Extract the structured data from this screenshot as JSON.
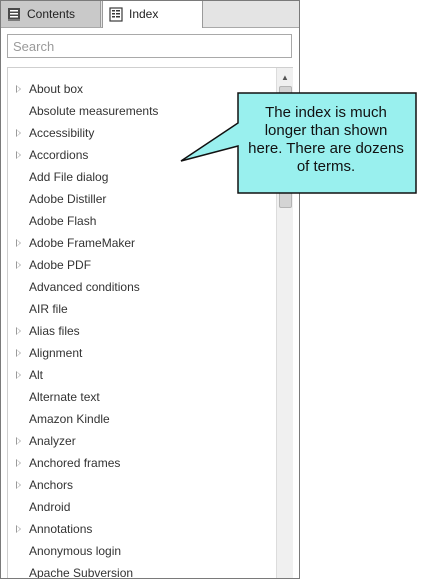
{
  "tabs": {
    "contents": {
      "label": "Contents",
      "icon": "book-icon"
    },
    "index": {
      "label": "Index",
      "icon": "index-page-icon"
    }
  },
  "search": {
    "placeholder": "Search",
    "value": ""
  },
  "index_items": [
    {
      "label": "About box",
      "expandable": true
    },
    {
      "label": "Absolute measurements",
      "expandable": false
    },
    {
      "label": "Accessibility",
      "expandable": true
    },
    {
      "label": "Accordions",
      "expandable": true
    },
    {
      "label": "Add File dialog",
      "expandable": false
    },
    {
      "label": "Adobe Distiller",
      "expandable": false
    },
    {
      "label": "Adobe Flash",
      "expandable": false
    },
    {
      "label": "Adobe FrameMaker",
      "expandable": true
    },
    {
      "label": "Adobe PDF",
      "expandable": true
    },
    {
      "label": "Advanced conditions",
      "expandable": false
    },
    {
      "label": "AIR file",
      "expandable": false
    },
    {
      "label": "Alias files",
      "expandable": true
    },
    {
      "label": "Alignment",
      "expandable": true
    },
    {
      "label": "Alt",
      "expandable": true
    },
    {
      "label": "Alternate text",
      "expandable": false
    },
    {
      "label": "Amazon Kindle",
      "expandable": false
    },
    {
      "label": "Analyzer",
      "expandable": true
    },
    {
      "label": "Anchored frames",
      "expandable": true
    },
    {
      "label": "Anchors",
      "expandable": true
    },
    {
      "label": "Android",
      "expandable": false
    },
    {
      "label": "Annotations",
      "expandable": true
    },
    {
      "label": "Anonymous login",
      "expandable": false
    },
    {
      "label": "Apache Subversion",
      "expandable": false
    }
  ],
  "callout": {
    "lines": [
      "The index is much",
      "longer than shown",
      "here. There are dozens",
      "of terms."
    ],
    "fill": "#99f0ee",
    "stroke": "#111111"
  },
  "colors": {
    "accent": "#99f0ee"
  }
}
